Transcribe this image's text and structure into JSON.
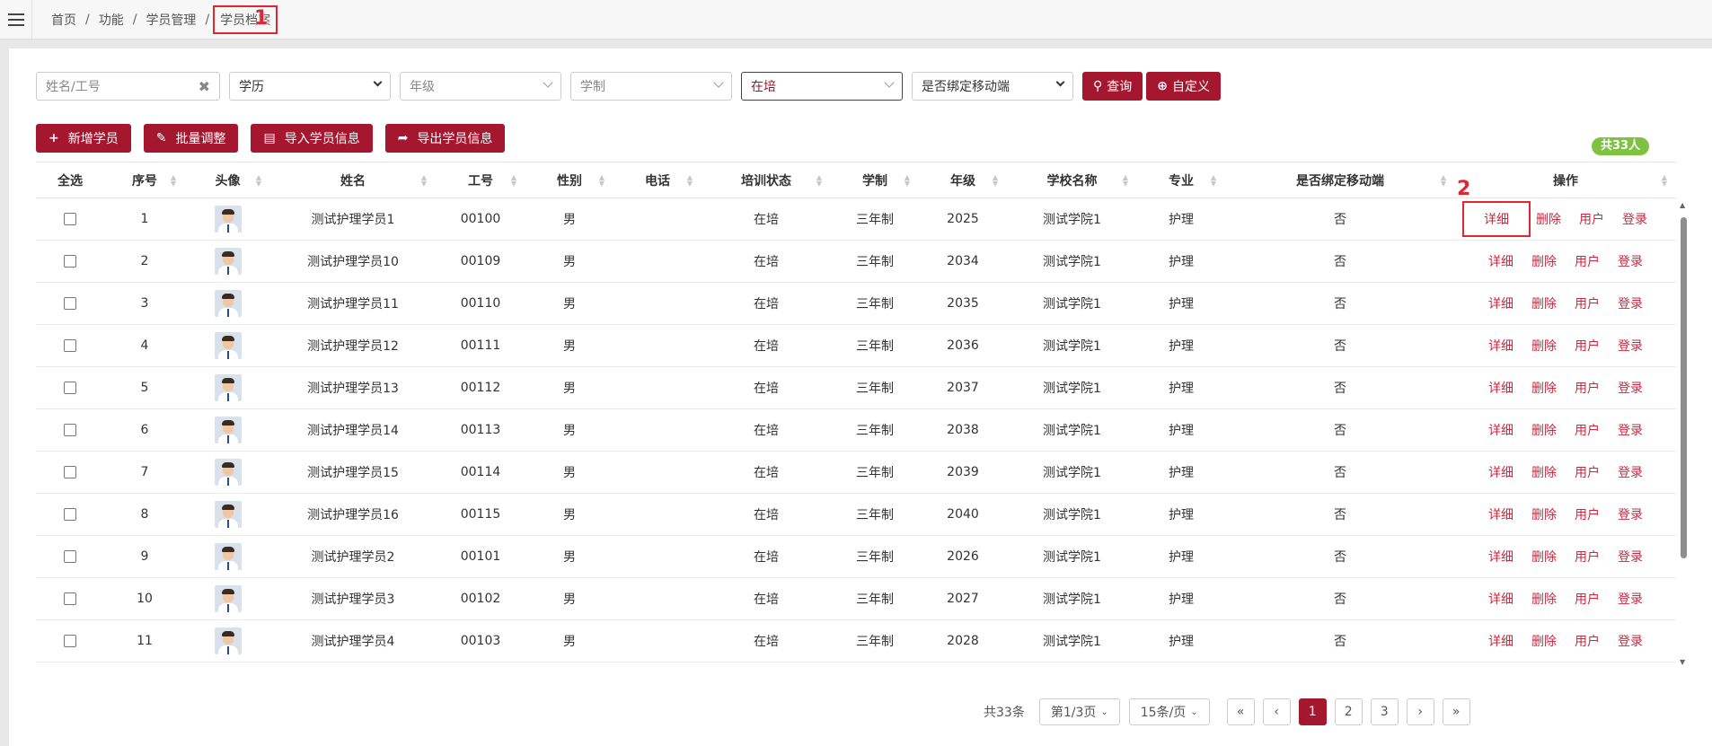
{
  "breadcrumb": {
    "items": [
      "首页",
      "功能",
      "学员管理"
    ],
    "current": "学员档案",
    "separator": "/"
  },
  "annotations": {
    "first": "1",
    "second": "2"
  },
  "filters": {
    "name_placeholder": "姓名/工号",
    "education": "学历",
    "grade": "年级",
    "school_system": "学制",
    "training_status": "在培",
    "mobile_bound": "是否绑定移动端",
    "query_label": "查询",
    "custom_label": "自定义"
  },
  "actions": {
    "add": "新增学员",
    "batch": "批量调整",
    "import": "导入学员信息",
    "export": "导出学员信息"
  },
  "total_badge": "共33人",
  "table": {
    "columns": [
      "全选",
      "序号",
      "头像",
      "姓名",
      "工号",
      "性别",
      "电话",
      "培训状态",
      "学制",
      "年级",
      "学校名称",
      "专业",
      "是否绑定移动端",
      "操作"
    ],
    "row_actions": [
      "详细",
      "删除",
      "用户",
      "登录"
    ],
    "rows": [
      {
        "no": "1",
        "name": "测试护理学员1",
        "id": "00100",
        "gender": "男",
        "phone": "",
        "status": "在培",
        "system": "三年制",
        "grade": "2025",
        "school": "测试学院1",
        "major": "护理",
        "bound": "否"
      },
      {
        "no": "2",
        "name": "测试护理学员10",
        "id": "00109",
        "gender": "男",
        "phone": "",
        "status": "在培",
        "system": "三年制",
        "grade": "2034",
        "school": "测试学院1",
        "major": "护理",
        "bound": "否"
      },
      {
        "no": "3",
        "name": "测试护理学员11",
        "id": "00110",
        "gender": "男",
        "phone": "",
        "status": "在培",
        "system": "三年制",
        "grade": "2035",
        "school": "测试学院1",
        "major": "护理",
        "bound": "否"
      },
      {
        "no": "4",
        "name": "测试护理学员12",
        "id": "00111",
        "gender": "男",
        "phone": "",
        "status": "在培",
        "system": "三年制",
        "grade": "2036",
        "school": "测试学院1",
        "major": "护理",
        "bound": "否"
      },
      {
        "no": "5",
        "name": "测试护理学员13",
        "id": "00112",
        "gender": "男",
        "phone": "",
        "status": "在培",
        "system": "三年制",
        "grade": "2037",
        "school": "测试学院1",
        "major": "护理",
        "bound": "否"
      },
      {
        "no": "6",
        "name": "测试护理学员14",
        "id": "00113",
        "gender": "男",
        "phone": "",
        "status": "在培",
        "system": "三年制",
        "grade": "2038",
        "school": "测试学院1",
        "major": "护理",
        "bound": "否"
      },
      {
        "no": "7",
        "name": "测试护理学员15",
        "id": "00114",
        "gender": "男",
        "phone": "",
        "status": "在培",
        "system": "三年制",
        "grade": "2039",
        "school": "测试学院1",
        "major": "护理",
        "bound": "否"
      },
      {
        "no": "8",
        "name": "测试护理学员16",
        "id": "00115",
        "gender": "男",
        "phone": "",
        "status": "在培",
        "system": "三年制",
        "grade": "2040",
        "school": "测试学院1",
        "major": "护理",
        "bound": "否"
      },
      {
        "no": "9",
        "name": "测试护理学员2",
        "id": "00101",
        "gender": "男",
        "phone": "",
        "status": "在培",
        "system": "三年制",
        "grade": "2026",
        "school": "测试学院1",
        "major": "护理",
        "bound": "否"
      },
      {
        "no": "10",
        "name": "测试护理学员3",
        "id": "00102",
        "gender": "男",
        "phone": "",
        "status": "在培",
        "system": "三年制",
        "grade": "2027",
        "school": "测试学院1",
        "major": "护理",
        "bound": "否"
      },
      {
        "no": "11",
        "name": "测试护理学员4",
        "id": "00103",
        "gender": "男",
        "phone": "",
        "status": "在培",
        "system": "三年制",
        "grade": "2028",
        "school": "测试学院1",
        "major": "护理",
        "bound": "否"
      }
    ]
  },
  "pagination": {
    "total": "共33条",
    "page_select": "第1/3页",
    "size_select": "15条/页",
    "first": "«",
    "prev": "‹",
    "pages": [
      "1",
      "2",
      "3"
    ],
    "next": "›",
    "last": "»"
  },
  "colors": {
    "primary": "#a5172f",
    "link": "#c9293f",
    "badge": "#7ec242",
    "highlight": "#e0262f"
  }
}
